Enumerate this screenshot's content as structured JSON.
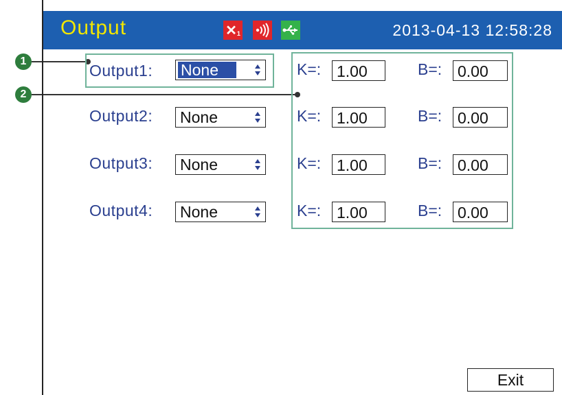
{
  "header": {
    "title": "Output",
    "datetime": "2013-04-13 12:58:28",
    "status_icons": [
      "alarm-x1-icon",
      "buzzer-icon",
      "usb-icon"
    ],
    "alarm_badge": "1"
  },
  "callouts": [
    "1",
    "2"
  ],
  "outputs": [
    {
      "label": "Output1:",
      "value": "None",
      "k_label": "K=:",
      "k_value": "1.00",
      "b_label": "B=:",
      "b_value": "0.00"
    },
    {
      "label": "Output2:",
      "value": "None",
      "k_label": "K=:",
      "k_value": "1.00",
      "b_label": "B=:",
      "b_value": "0.00"
    },
    {
      "label": "Output3:",
      "value": "None",
      "k_label": "K=:",
      "k_value": "1.00",
      "b_label": "B=:",
      "b_value": "0.00"
    },
    {
      "label": "Output4:",
      "value": "None",
      "k_label": "K=:",
      "k_value": "1.00",
      "b_label": "B=:",
      "b_value": "0.00"
    }
  ],
  "footer": {
    "exit_label": "Exit"
  },
  "colors": {
    "header_bg": "#1d5fb0",
    "title": "#f2e600",
    "label": "#2a3f8f",
    "callout": "#2e7d3d"
  }
}
